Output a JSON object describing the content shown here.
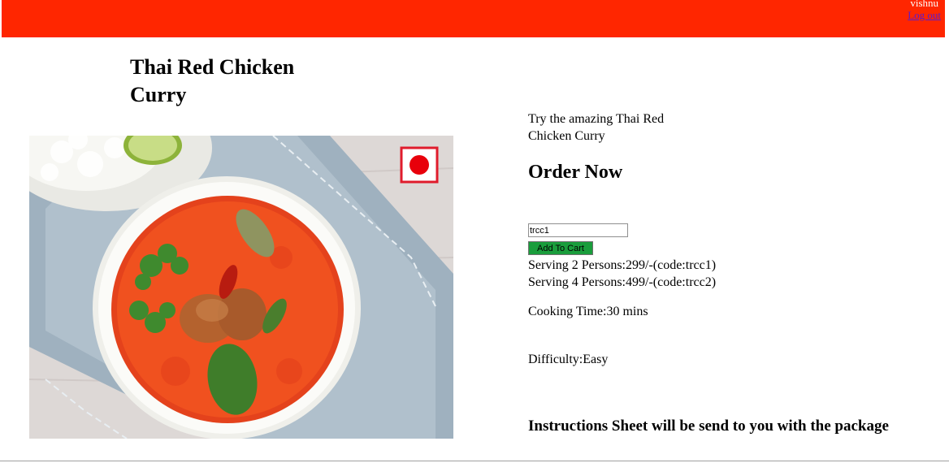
{
  "header": {
    "user_name": "vishnu",
    "logout_label": "Log out",
    "bar_color": "#ff2600"
  },
  "dish": {
    "title": "Thai Red Chicken Curry",
    "image_icon": "food-photo",
    "badge_icon": "non-veg-mark-icon"
  },
  "details": {
    "tagline": "Try the amazing Thai Red Chicken Curry",
    "order_heading": "Order Now",
    "code_input_value": "trcc1",
    "add_to_cart_label": "Add To Cart",
    "add_to_cart_color": "#1a9d3c",
    "serving_options": [
      "Serving 2 Persons:299/-(code:trcc1)",
      "Serving 4 Persons:499/-(code:trcc2)"
    ],
    "cooking_time": "Cooking Time:30 mins",
    "difficulty": "Difficulty:Easy",
    "instructions": "Instructions Sheet will be send to you with the package"
  }
}
